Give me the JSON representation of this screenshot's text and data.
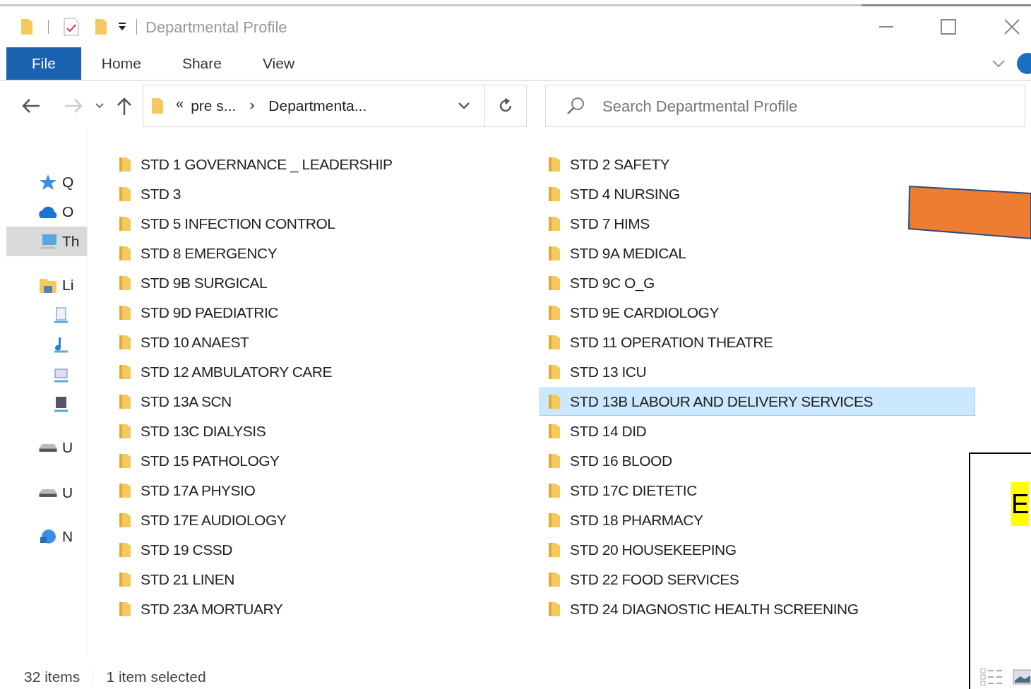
{
  "window": {
    "title": "Departmental Profile"
  },
  "ribbon_tabs": [
    {
      "label": "File",
      "selected": true
    },
    {
      "label": "Home",
      "selected": false
    },
    {
      "label": "Share",
      "selected": false
    },
    {
      "label": "View",
      "selected": false
    }
  ],
  "address": {
    "overflow": "«",
    "crumbs": [
      "pre s...",
      "Departmenta..."
    ]
  },
  "search": {
    "placeholder": "Search Departmental Profile"
  },
  "nav_pane": [
    {
      "kind": "star",
      "label": "Q",
      "selected": false
    },
    {
      "kind": "cloud",
      "label": "O",
      "selected": false
    },
    {
      "kind": "pc",
      "label": "Th",
      "selected": true
    },
    {
      "kind": "library",
      "label": "Li",
      "selected": false
    },
    {
      "kind": "doc",
      "selected": false
    },
    {
      "kind": "music",
      "selected": false
    },
    {
      "kind": "image",
      "selected": false
    },
    {
      "kind": "video",
      "selected": false
    },
    {
      "kind": "drive",
      "label": "U",
      "selected": false
    },
    {
      "kind": "drive",
      "label": "U",
      "selected": false
    },
    {
      "kind": "network",
      "label": "N",
      "selected": false
    }
  ],
  "files": [
    {
      "name": "STD 1 GOVERNANCE _ LEADERSHIP",
      "selected": false
    },
    {
      "name": "STD 2 SAFETY",
      "selected": false
    },
    {
      "name": "STD 3",
      "selected": false
    },
    {
      "name": "STD 4 NURSING",
      "selected": false
    },
    {
      "name": "STD 5 INFECTION CONTROL",
      "selected": false
    },
    {
      "name": "STD 7 HIMS",
      "selected": false
    },
    {
      "name": "STD 8 EMERGENCY",
      "selected": false
    },
    {
      "name": "STD 9A MEDICAL",
      "selected": false
    },
    {
      "name": "STD 9B SURGICAL",
      "selected": false
    },
    {
      "name": "STD 9C O_G",
      "selected": false
    },
    {
      "name": "STD 9D PAEDIATRIC",
      "selected": false
    },
    {
      "name": "STD 9E CARDIOLOGY",
      "selected": false
    },
    {
      "name": "STD 10 ANAEST",
      "selected": false
    },
    {
      "name": "STD 11 OPERATION THEATRE",
      "selected": false
    },
    {
      "name": "STD 12 AMBULATORY CARE",
      "selected": false
    },
    {
      "name": "STD 13 ICU",
      "selected": false
    },
    {
      "name": "STD 13A SCN",
      "selected": false
    },
    {
      "name": "STD 13B LABOUR AND DELIVERY SERVICES",
      "selected": true
    },
    {
      "name": "STD 13C DIALYSIS",
      "selected": false
    },
    {
      "name": "STD 14 DID",
      "selected": false
    },
    {
      "name": "STD 15 PATHOLOGY",
      "selected": false
    },
    {
      "name": "STD 16 BLOOD",
      "selected": false
    },
    {
      "name": "STD 17A PHYSIO",
      "selected": false
    },
    {
      "name": "STD 17C DIETETIC",
      "selected": false
    },
    {
      "name": "STD 17E AUDIOLOGY",
      "selected": false
    },
    {
      "name": "STD 18 PHARMACY",
      "selected": false
    },
    {
      "name": "STD 19 CSSD",
      "selected": false
    },
    {
      "name": "STD 20 HOUSEKEEPING",
      "selected": false
    },
    {
      "name": "STD 21 LINEN",
      "selected": false
    },
    {
      "name": "STD 22 FOOD SERVICES",
      "selected": false
    },
    {
      "name": "STD 23A MORTUARY",
      "selected": false
    },
    {
      "name": "STD 24 DIAGNOSTIC HEALTH SCREENING",
      "selected": false
    }
  ],
  "status_bar": {
    "count": "32 items",
    "selection": "1 item selected"
  },
  "overlay_box": {
    "letter": "E"
  }
}
